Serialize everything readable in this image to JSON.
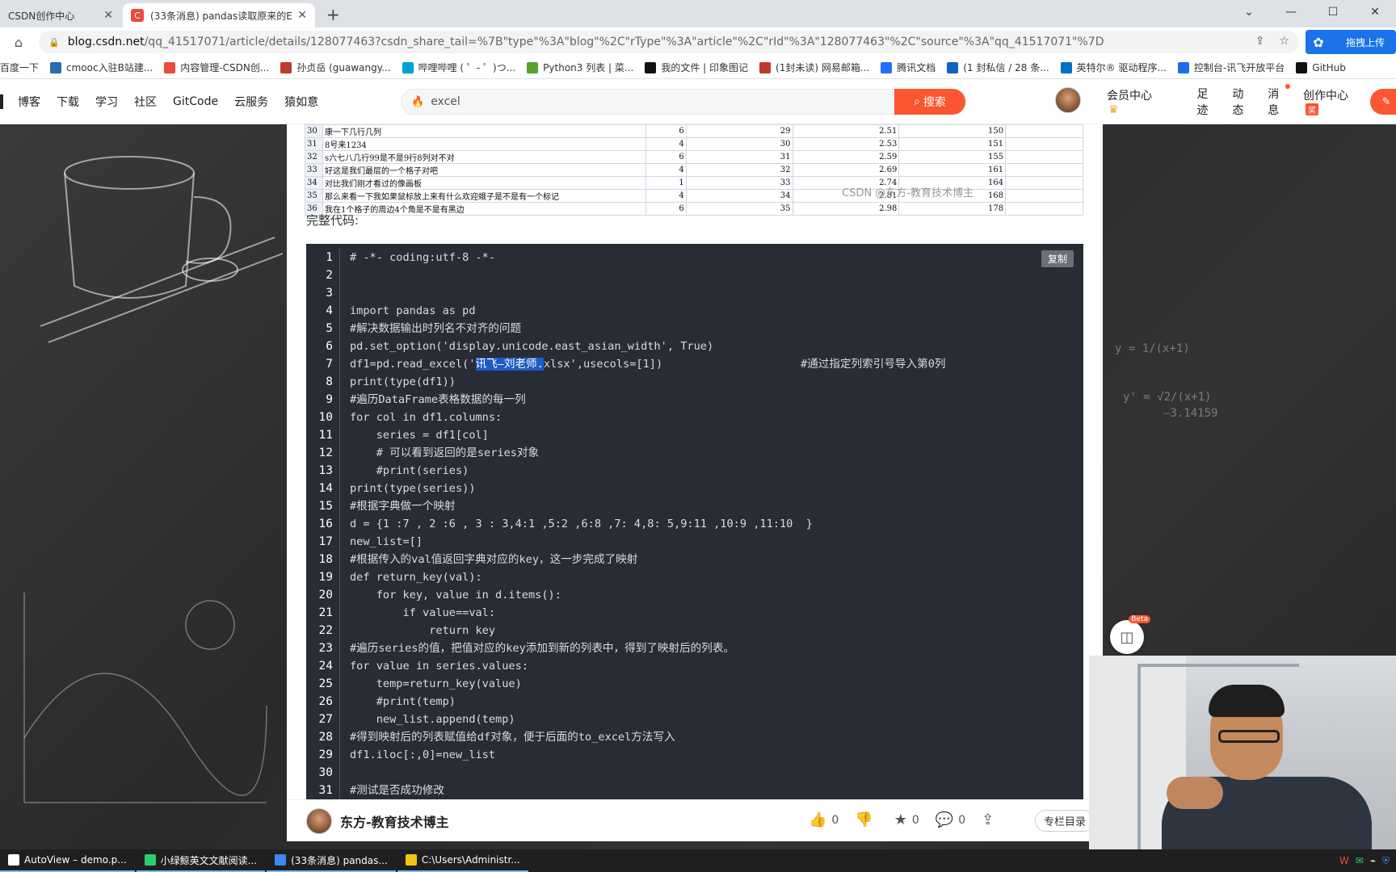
{
  "browser": {
    "tabs": [
      {
        "label": "CSDN创作中心",
        "active": false
      },
      {
        "label": "(33条消息) pandas读取原来的E",
        "active": true
      }
    ],
    "new_tab": "+",
    "url_host": "blog.csdn.net",
    "url_rest": "/qq_41517071/article/details/128077463?csdn_share_tail=%7B\"type\"%3A\"blog\"%2C\"rType\"%3A\"article\"%2C\"rId\"%3A\"128077463\"%2C\"source\"%3A\"qq_41517071\"%7D",
    "extension_label": "拖拽上传"
  },
  "bookmarks": [
    {
      "label": "百度一下",
      "color": "#ffffff"
    },
    {
      "label": "cmooc入驻B站建...",
      "color": "#2b6cb0"
    },
    {
      "label": "内容管理-CSDN创...",
      "color": "#e74c3c"
    },
    {
      "label": "孙贞岳 (guawangy...",
      "color": "#c0392b"
    },
    {
      "label": "哔哩哔哩 ( ゜- ゜)つ...",
      "color": "#00a1d6"
    },
    {
      "label": "Python3 列表 | 菜...",
      "color": "#5aa02c"
    },
    {
      "label": "我的文件 | 印象图记",
      "color": "#111111"
    },
    {
      "label": "(1封未读) 网易邮箱...",
      "color": "#c0392b"
    },
    {
      "label": "腾讯文档",
      "color": "#1e6fff"
    },
    {
      "label": "(1 封私信 / 28 条...",
      "color": "#0a66c2"
    },
    {
      "label": "英特尔® 驱动程序...",
      "color": "#0071c5"
    },
    {
      "label": "控制台-讯飞开放平台",
      "color": "#1f6feb"
    },
    {
      "label": "GitHub",
      "color": "#111111"
    }
  ],
  "csdn_nav": {
    "links": [
      "博客",
      "下载",
      "学习",
      "社区",
      "GitCode",
      "云服务",
      "猿如意"
    ],
    "search_value": "excel",
    "search_button": "搜索",
    "right": [
      "会员中心",
      "足迹",
      "动态",
      "消息",
      "创作中心"
    ]
  },
  "table": {
    "rows": [
      {
        "n": "30",
        "text": "康一下几行几列",
        "a": "6",
        "b": "29",
        "c": "2.51",
        "d": "150"
      },
      {
        "n": "31",
        "text": "8号来1234",
        "a": "4",
        "b": "30",
        "c": "2.53",
        "d": "151"
      },
      {
        "n": "32",
        "text": "s六七八几行99是不是9行8列对不对",
        "a": "6",
        "b": "31",
        "c": "2.59",
        "d": "155"
      },
      {
        "n": "33",
        "text": "好这是我们最层的一个格子对吧",
        "a": "4",
        "b": "32",
        "c": "2.69",
        "d": "161"
      },
      {
        "n": "34",
        "text": "对比我们刚才看过的像画板",
        "a": "1",
        "b": "33",
        "c": "2.74",
        "d": "164"
      },
      {
        "n": "35",
        "text": "那么来看一下我如果鼠标放上来有什么欢迎蛾子是不是有一个标记",
        "a": "4",
        "b": "34",
        "c": "2.81",
        "d": "168"
      },
      {
        "n": "36",
        "text": "我在1个格子的周边4个角是不是有黑边",
        "a": "6",
        "b": "35",
        "c": "2.98",
        "d": "178"
      }
    ],
    "watermark": "CSDN @东方-教育技术博主"
  },
  "article": {
    "full_code_title": "完整代码:",
    "copy_label": "复制"
  },
  "code": [
    {
      "n": "1",
      "text": "# -*- coding:utf-8 -*-"
    },
    {
      "n": "2",
      "text": ""
    },
    {
      "n": "3",
      "text": ""
    },
    {
      "n": "4",
      "text": "import pandas as pd"
    },
    {
      "n": "5",
      "text": "#解决数据输出时列名不对齐的问题"
    },
    {
      "n": "6",
      "text": "pd.set_option('display.unicode.east_asian_width', True)"
    },
    {
      "n": "7",
      "pre": "df1=pd.read_excel('",
      "hl": "讯飞—刘老师.",
      "post": "xlsx',usecols=[1])",
      "comment": "#通过指定列索引号导入第0列"
    },
    {
      "n": "8",
      "text": "print(type(df1))"
    },
    {
      "n": "9",
      "text": "#遍历DataFrame表格数据的每一列"
    },
    {
      "n": "10",
      "text": "for col in df1.columns:"
    },
    {
      "n": "11",
      "text": "    series = df1[col]"
    },
    {
      "n": "12",
      "text": "    # 可以看到返回的是series对象"
    },
    {
      "n": "13",
      "text": "    #print(series)"
    },
    {
      "n": "14",
      "text": "print(type(series))"
    },
    {
      "n": "15",
      "text": "#根据字典做一个映射"
    },
    {
      "n": "16",
      "text": "d = {1 :7 , 2 :6 , 3 : 3,4:1 ,5:2 ,6:8 ,7: 4,8: 5,9:11 ,10:9 ,11:10  }"
    },
    {
      "n": "17",
      "text": "new_list=[]"
    },
    {
      "n": "18",
      "text": "#根据传入的val值返回字典对应的key，这一步完成了映射"
    },
    {
      "n": "19",
      "text": "def return_key(val):"
    },
    {
      "n": "20",
      "text": "    for key, value in d.items():"
    },
    {
      "n": "21",
      "text": "        if value==val:"
    },
    {
      "n": "22",
      "text": "            return key"
    },
    {
      "n": "23",
      "text": "#遍历series的值，把值对应的key添加到新的列表中，得到了映射后的列表。"
    },
    {
      "n": "24",
      "text": "for value in series.values:"
    },
    {
      "n": "25",
      "text": "    temp=return_key(value)"
    },
    {
      "n": "26",
      "text": "    #print(temp)"
    },
    {
      "n": "27",
      "text": "    new_list.append(temp)"
    },
    {
      "n": "28",
      "text": "#得到映射后的列表赋值给df对象，便于后面的to_excel方法写入"
    },
    {
      "n": "29",
      "text": "df1.iloc[:,0]=new_list"
    },
    {
      "n": "30",
      "text": ""
    },
    {
      "n": "31",
      "text": "#测试是否成功修改"
    }
  ],
  "beta_label": "Beta",
  "author": {
    "name": "东方-教育技术博主",
    "likes": "0",
    "favorites": "0",
    "comments": "0",
    "column_button": "专栏目录"
  },
  "taskbar": [
    {
      "label": "AutoView – demo.p...",
      "color": "#ffffff"
    },
    {
      "label": "小绿鲸英文文献阅读...",
      "color": "#2ecc71"
    },
    {
      "label": "(33条消息) pandas...",
      "color": "#4285f4"
    },
    {
      "label": "C:\\Users\\Administr...",
      "color": "#f1c40f"
    }
  ]
}
